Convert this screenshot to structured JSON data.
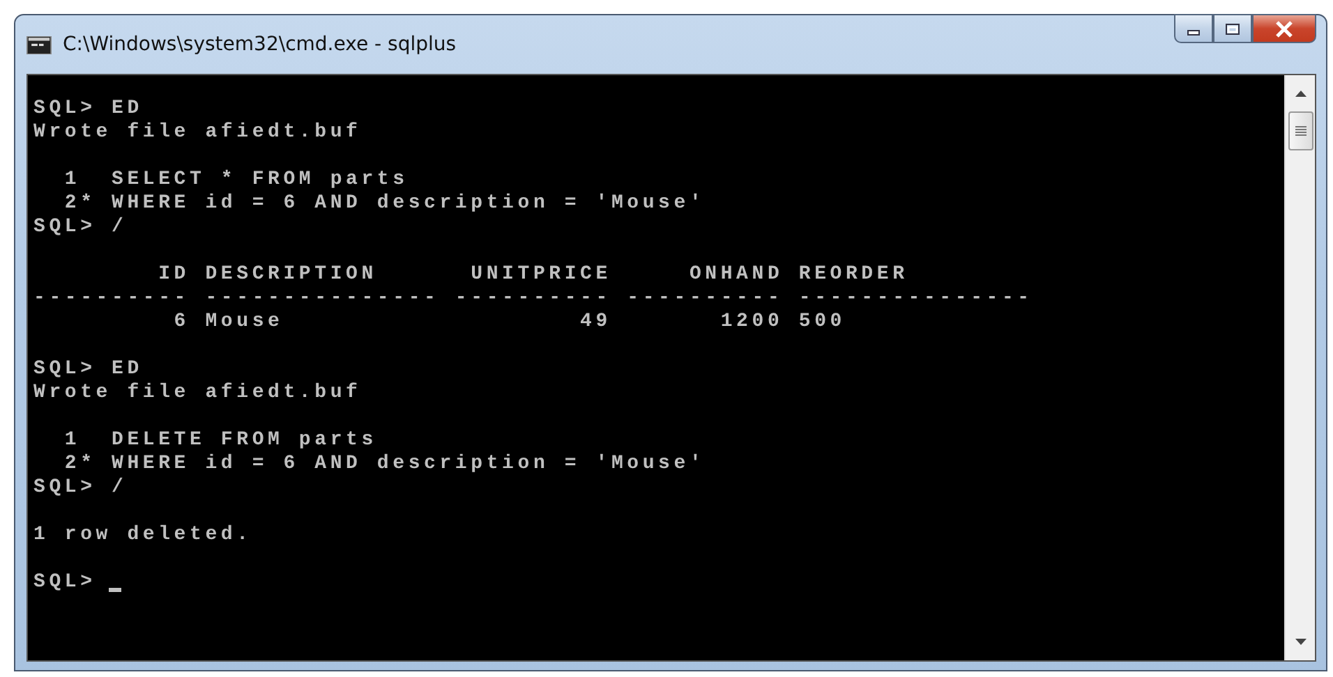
{
  "window": {
    "title": "C:\\Windows\\system32\\cmd.exe - sqlplus"
  },
  "console": {
    "blocks": [
      {
        "lines": [
          {
            "text": "SQL> ED"
          },
          {
            "text": "Wrote file afiedt.buf"
          }
        ]
      },
      {
        "lines": [
          {
            "text": "  1  SELECT * FROM parts"
          },
          {
            "text": "  2* WHERE id = 6 AND description = 'Mouse'"
          },
          {
            "text": "SQL> /"
          }
        ]
      },
      {
        "lines": [
          {
            "text": "        ID DESCRIPTION      UNITPRICE     ONHAND REORDER"
          },
          {
            "text": "---------- --------------- ---------- ---------- ---------------"
          },
          {
            "text": "         6 Mouse                   49       1200 500"
          }
        ]
      },
      {
        "lines": [
          {
            "text": "SQL> ED"
          },
          {
            "text": "Wrote file afiedt.buf"
          }
        ]
      },
      {
        "lines": [
          {
            "text": "  1  DELETE FROM parts"
          },
          {
            "text": "  2* WHERE id = 6 AND description = 'Mouse'"
          },
          {
            "text": "SQL> /"
          }
        ]
      },
      {
        "lines": [
          {
            "text": "1 row deleted."
          }
        ]
      },
      {
        "lines": [
          {
            "text": "SQL>",
            "cursor": true
          }
        ]
      }
    ]
  }
}
